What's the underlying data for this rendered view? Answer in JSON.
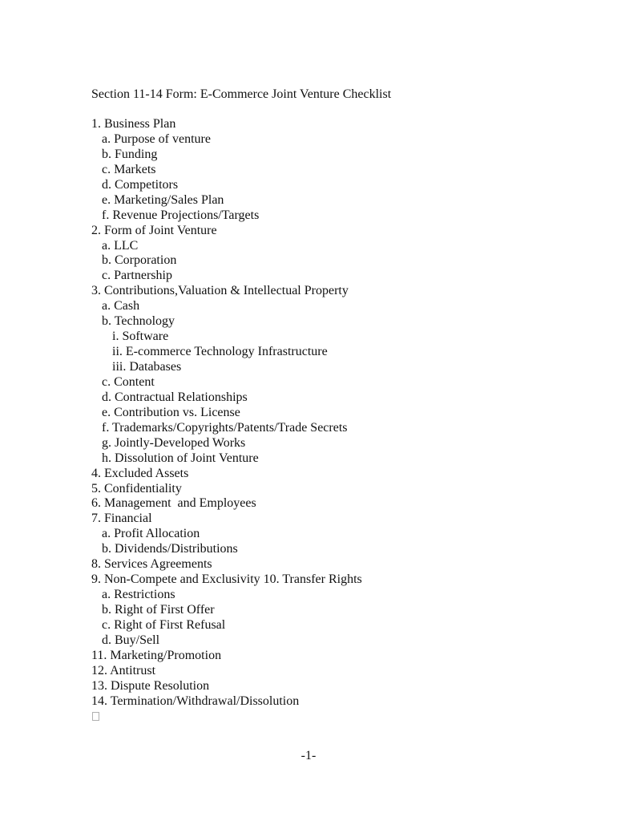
{
  "document": {
    "title": "Section 11-14 Form: E-Commerce Joint Venture Checklist",
    "items": [
      {
        "level": 1,
        "text": "1. Business Plan"
      },
      {
        "level": 2,
        "text": "a. Purpose of venture"
      },
      {
        "level": 2,
        "text": "b. Funding"
      },
      {
        "level": 2,
        "text": "c. Markets"
      },
      {
        "level": 2,
        "text": "d. Competitors"
      },
      {
        "level": 2,
        "text": "e. Marketing/Sales Plan"
      },
      {
        "level": 2,
        "text": "f. Revenue Projections/Targets"
      },
      {
        "level": 1,
        "text": "2. Form of Joint Venture"
      },
      {
        "level": 2,
        "text": "a. LLC"
      },
      {
        "level": 2,
        "text": "b. Corporation"
      },
      {
        "level": 2,
        "text": "c. Partnership"
      },
      {
        "level": 1,
        "text": "3. Contributions,Valuation & Intellectual Property"
      },
      {
        "level": 2,
        "text": "a. Cash"
      },
      {
        "level": 2,
        "text": "b. Technology"
      },
      {
        "level": 3,
        "text": "i. Software"
      },
      {
        "level": 3,
        "text": "ii. E-commerce Technology Infrastructure"
      },
      {
        "level": 3,
        "text": "iii. Databases"
      },
      {
        "level": 2,
        "text": "c. Content"
      },
      {
        "level": 2,
        "text": "d. Contractual Relationships"
      },
      {
        "level": 2,
        "text": "e. Contribution vs. License"
      },
      {
        "level": 2,
        "text": "f. Trademarks/Copyrights/Patents/Trade Secrets"
      },
      {
        "level": 2,
        "text": "g. Jointly-Developed Works"
      },
      {
        "level": 2,
        "text": "h. Dissolution of Joint Venture"
      },
      {
        "level": 1,
        "text": "4. Excluded Assets"
      },
      {
        "level": 1,
        "text": "5. Confidentiality"
      },
      {
        "level": 1,
        "text": "6. Management  and Employees"
      },
      {
        "level": 1,
        "text": "7. Financial"
      },
      {
        "level": 2,
        "text": "a. Profit Allocation"
      },
      {
        "level": 2,
        "text": "b. Dividends/Distributions"
      },
      {
        "level": 1,
        "text": "8. Services Agreements"
      },
      {
        "level": 1,
        "text": "9. Non-Compete and Exclusivity 10. Transfer Rights"
      },
      {
        "level": 2,
        "text": "a. Restrictions"
      },
      {
        "level": 2,
        "text": "b. Right of First Offer"
      },
      {
        "level": 2,
        "text": "c. Right of First Refusal"
      },
      {
        "level": 2,
        "text": "d. Buy/Sell"
      },
      {
        "level": 1,
        "text": "11. Marketing/Promotion"
      },
      {
        "level": 1,
        "text": "12. Antitrust"
      },
      {
        "level": 1,
        "text": "13. Dispute Resolution"
      },
      {
        "level": 1,
        "text": "14. Termination/Withdrawal/Dissolution"
      }
    ],
    "checkbox_icon": "empty-checkbox-icon",
    "page_number": "-1-"
  }
}
